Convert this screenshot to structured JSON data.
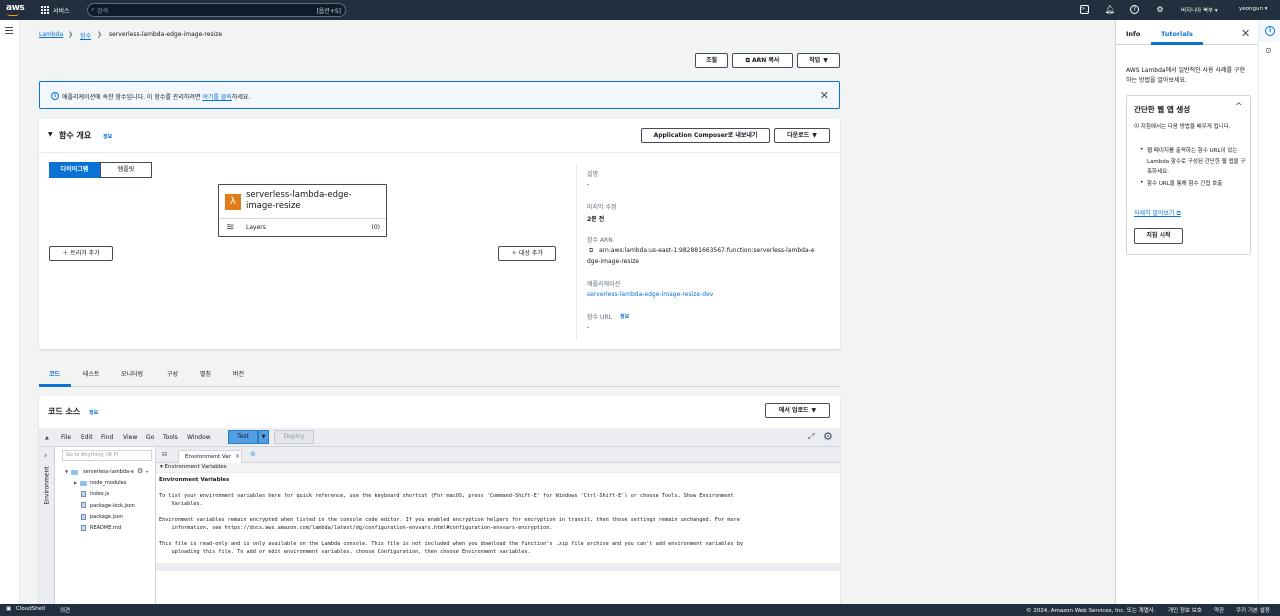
{
  "topnav": {
    "logo": "aws",
    "services_label": "서비스",
    "search_placeholder": "검색",
    "search_shortcut": "[옵션+S]",
    "region": "버지니아 북부 ▾",
    "user": "yeongun ▾",
    "icons": [
      "cloudshell-icon",
      "bell-icon",
      "help-icon",
      "gear-icon"
    ]
  },
  "breadcrumb": {
    "items": [
      "Lambda",
      "함수",
      "serverless-lambda-edge-image-resize"
    ]
  },
  "header": {
    "title": "serverless-lambda-edge-image-resize",
    "throttle_label": "조절",
    "copy_arn_label": "ARN 복사",
    "actions_label": "작업"
  },
  "banner": {
    "text_before": "애플리케이션에 속한 함수입니다. 이 함수를 관리하려면 ",
    "link_text": "여기를 클릭",
    "text_after": "하세요."
  },
  "overview": {
    "title": "함수 개요",
    "info_label": "정보",
    "export_label": "Application Composer로 내보내기",
    "download_label": "다운로드",
    "seg_diagram": "다이어그램",
    "seg_template": "템플릿",
    "function_name_line1": "serverless-lambda-edge-",
    "function_name_line2": "image-resize",
    "layers_label": "Layers",
    "layers_count": "(0)",
    "add_trigger_label": "트리거 추가",
    "add_destination_label": "대상 추가",
    "description_label": "설명",
    "description_value": "-",
    "last_modified_label": "마지막 수정",
    "last_modified_value": "2분 전",
    "arn_label": "함수 ARN",
    "arn_line1": "arn:aws:lambda:us-east-1:982881663567:function:serverless-lambda-e",
    "arn_line2": "dge-image-resize",
    "application_label": "애플리케이션",
    "application_value": "serverless-lambda-edge-image-resize-dev",
    "function_url_label": "함수 URL",
    "function_url_info": "정보",
    "function_url_value": "-"
  },
  "tabs": [
    "코드",
    "테스트",
    "모니터링",
    "구성",
    "별칭",
    "버전"
  ],
  "code_source": {
    "title": "코드 소스",
    "info_label": "정보",
    "upload_label": "에서 업로드",
    "menu": [
      "File",
      "Edit",
      "Find",
      "View",
      "Go",
      "Tools",
      "Window"
    ],
    "test_label": "Test",
    "deploy_label": "Deploy",
    "goto_placeholder": "Go to Anything (⌘ P)",
    "side_label": "Environment",
    "tree_root": "serverless-lambda-e",
    "tree_items": [
      "node_modules",
      "index.js",
      "package-lock.json",
      "package.json",
      "README.md"
    ],
    "editor_tab": "Environment Var",
    "section_header": "Environment Variables",
    "heading": "Environment Variables",
    "para1_line1": "To list your environment variables here for quick reference, use the keyboard shortcut (For macOS, press 'Command-Shift-E' for Windows 'Ctrl-Shift-E') or choose Tools, Show Environment",
    "para1_line2": "    Variables.",
    "para2_line1": "Environment variables remain encrypted when listed in the console code editor. If you enabled encryption helpers for encryption in transit, then those settings remain unchanged. For more",
    "para2_line2": "    information, see https://docs.aws.amazon.com/lambda/latest/dg/configuration-envvars.html#configuration-envvars-encryption.",
    "para3_line1": "This file is read-only and is only available on the Lambda console. This file is not included when you download the function's .zip file archive and you can't add environment variables by",
    "para3_line2": "    uploading this file. To add or edit environment variables, choose Configuration, then choose Environment variables."
  },
  "help_panel": {
    "tab_info": "Info",
    "tab_tutorials": "Tutorials",
    "intro": "AWS Lambda에서 일반적인 사용 사례를 구현하는 방법을 알아보세요.",
    "card_title": "간단한 웹 앱 생성",
    "card_body": "이 지침에서는 다음 방법을 배우게 됩니다.",
    "bullet1": "웹 페이지를 출력하는 함수 URL이 있는 Lambda 함수로 구성된 간단한 웹 앱을 구축하세요.",
    "bullet2": "함수 URL을 통해 함수 간접 호출",
    "learn_more": "자세히 알아보기",
    "start_label": "지침 시작"
  },
  "footer": {
    "cloudshell": "CloudShell",
    "feedback": "의견",
    "copyright": "© 2024, Amazon Web Services, Inc. 또는 계열사.",
    "privacy": "개인 정보 보호",
    "terms": "약관",
    "cookies": "쿠키 기본 설정"
  },
  "colors": {
    "nav_bg": "#232f3e",
    "link": "#0972d3",
    "lambda_orange": "#e07d19",
    "primary_test": "#539fe5"
  }
}
